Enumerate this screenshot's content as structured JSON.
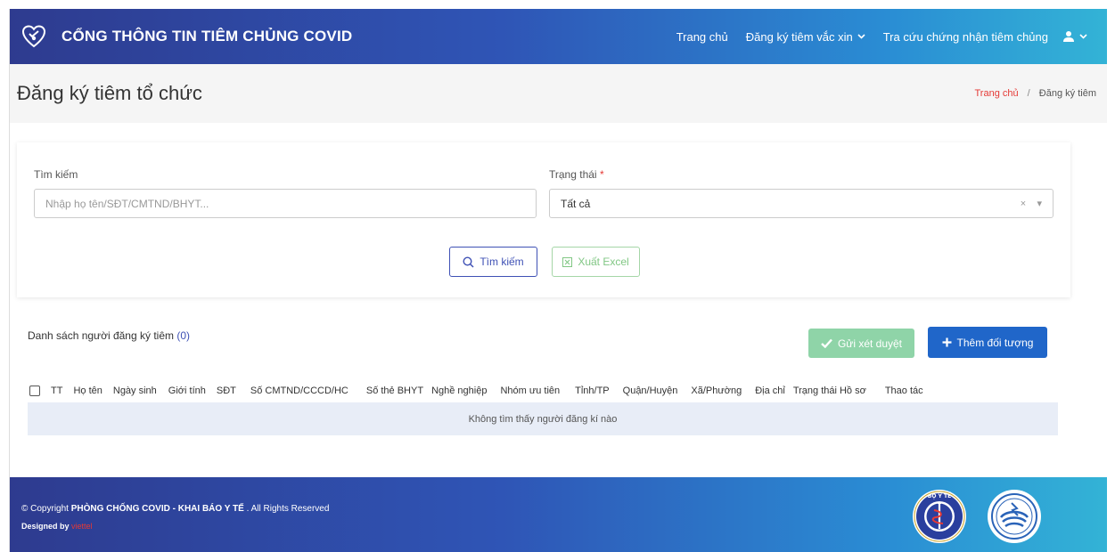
{
  "header": {
    "title": "CỔNG THÔNG TIN TIÊM CHỦNG COVID",
    "nav": [
      {
        "label": "Trang chủ"
      },
      {
        "label": "Đăng ký tiêm vắc xin"
      },
      {
        "label": "Tra cứu chứng nhận tiêm chủng"
      }
    ],
    "icons": {
      "logo": "heart-shield-logo",
      "user": "user-icon",
      "chevron": "chevron-down-icon"
    }
  },
  "titlebar": {
    "title": "Đăng ký tiêm tổ chức",
    "breadcrumb_home": "Trang chủ",
    "breadcrumb_sep": "/",
    "breadcrumb_current": "Đăng ký tiêm"
  },
  "filter": {
    "search_label": "Tìm kiếm",
    "search_placeholder": "Nhập họ tên/SĐT/CMTND/BHYT...",
    "status_label": "Trạng thái",
    "status_required_mark": "*",
    "status_value": "Tất cả",
    "clear_glyph": "×",
    "caret_glyph": "▾",
    "search_button": "Tìm kiếm",
    "excel_button": "Xuất Excel"
  },
  "list": {
    "title": "Danh sách người đăng ký tiêm",
    "count": "(0)",
    "approve_button": "Gửi xét duyệt",
    "add_button": "Thêm đối tượng",
    "columns": [
      "TT",
      "Họ tên",
      "Ngày sinh",
      "Giới tính",
      "SĐT",
      "Số CMTND/CCCD/HC",
      "Số thẻ BHYT",
      "Nghề nghiệp",
      "Nhóm ưu tiên",
      "Tỉnh/TP",
      "Quận/Huyện",
      "Xã/Phường",
      "Địa chỉ",
      "Trạng thái Hồ sơ",
      "Thao tác"
    ],
    "empty_message": "Không tìm thấy người đăng kí nào"
  },
  "footer": {
    "copyright_prefix": "© Copyright",
    "copyright_org": "PHÒNG CHỐNG COVID - KHAI BÁO Y TẾ",
    "copyright_suffix": ". All Rights Reserved",
    "designed_by": "Designed by",
    "designer": "viettel",
    "seal_left_text": "BỘ Y TẾ"
  },
  "colors": {
    "accent": "#3f51b5",
    "danger": "#e53935",
    "success_light": "#8fd4a8",
    "primary": "#2066c9"
  }
}
